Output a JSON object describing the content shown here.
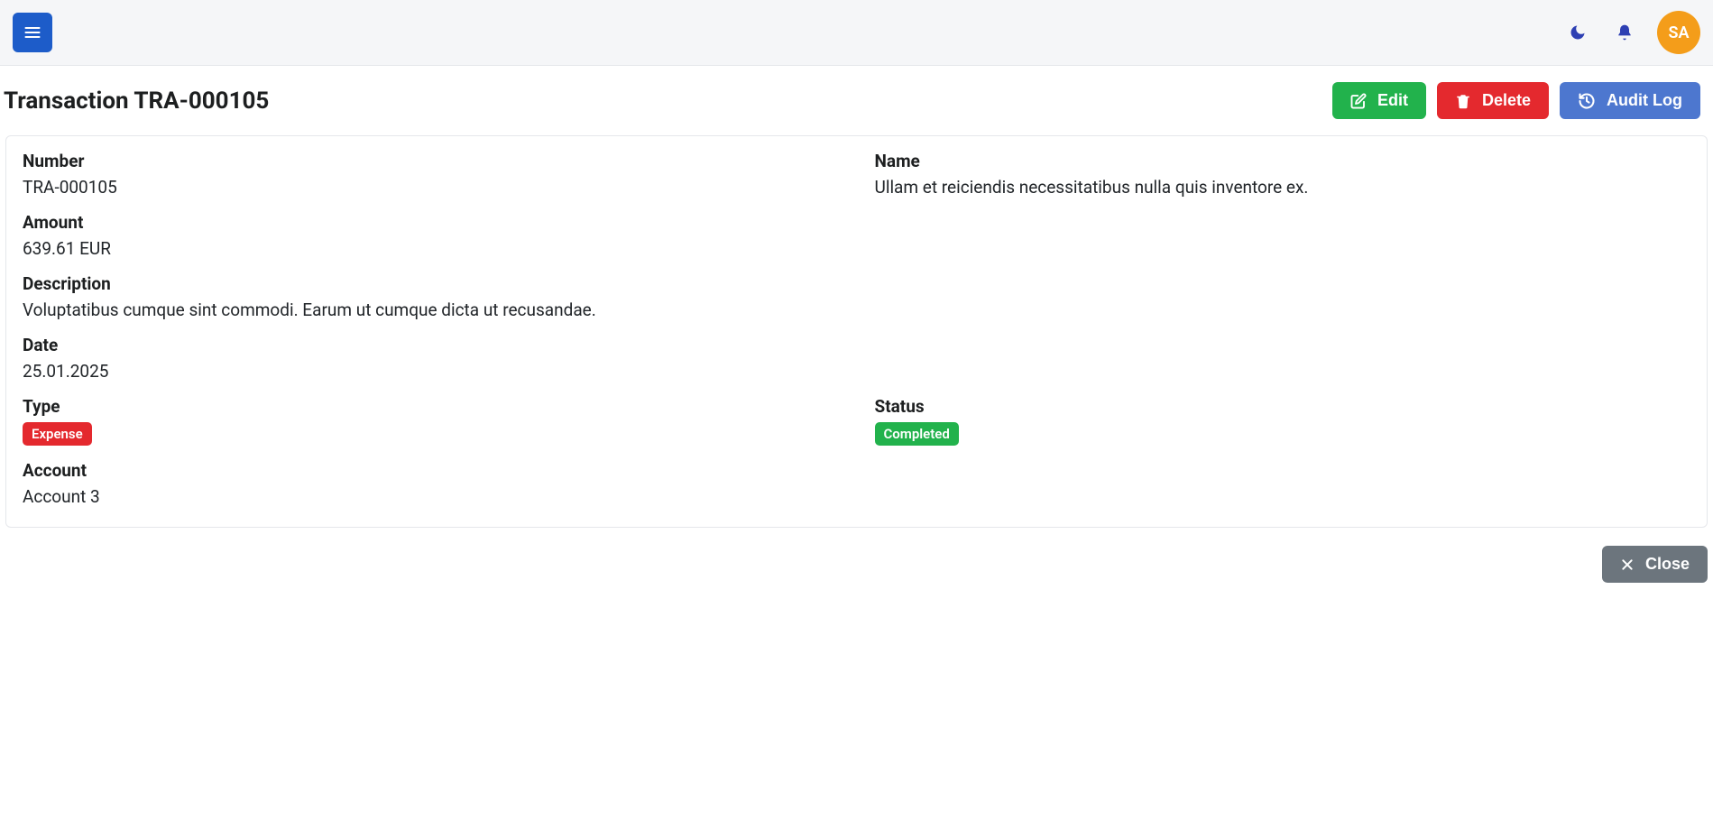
{
  "header": {
    "avatar_initials": "SA"
  },
  "page": {
    "title": "Transaction TRA-000105"
  },
  "actions": {
    "edit": "Edit",
    "delete": "Delete",
    "audit_log": "Audit Log",
    "close": "Close"
  },
  "labels": {
    "number": "Number",
    "name": "Name",
    "amount": "Amount",
    "description": "Description",
    "date": "Date",
    "type": "Type",
    "status": "Status",
    "account": "Account"
  },
  "transaction": {
    "number": "TRA-000105",
    "name": "Ullam et reiciendis necessitatibus nulla quis inventore ex.",
    "amount": "639.61 EUR",
    "description": "Voluptatibus cumque sint commodi. Earum ut cumque dicta ut recusandae.",
    "date": "25.01.2025",
    "type": "Expense",
    "status": "Completed",
    "account": "Account 3"
  }
}
